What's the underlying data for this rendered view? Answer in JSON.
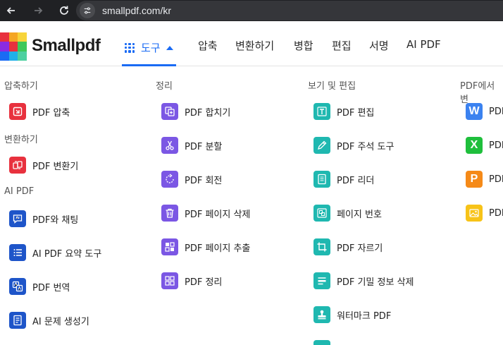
{
  "browser": {
    "url": "smallpdf.com/kr"
  },
  "header": {
    "brand": "Smallpdf",
    "tools_label": "도구",
    "nav": [
      "압축",
      "변환하기",
      "병합",
      "편집",
      "서명",
      "AI PDF"
    ],
    "colors": {
      "accent": "#1a6bf4"
    }
  },
  "menu": {
    "compress_heading": "압축하기",
    "compress_items": [
      {
        "label": "PDF 압축",
        "icon": "compress-icon"
      }
    ],
    "convert_heading": "변환하기",
    "convert_items": [
      {
        "label": "PDF 변환기",
        "icon": "convert-icon"
      }
    ],
    "ai_heading": "AI PDF",
    "ai_items": [
      {
        "label": "PDF와 채팅",
        "icon": "chat-icon"
      },
      {
        "label": "AI PDF 요약 도구",
        "icon": "summary-list-icon"
      },
      {
        "label": "PDF 번역",
        "icon": "translate-icon"
      },
      {
        "label": "AI 문제 생성기",
        "icon": "question-generator-icon"
      }
    ],
    "organize_heading": "정리",
    "organize_items": [
      {
        "label": "PDF 합치기",
        "icon": "merge-icon"
      },
      {
        "label": "PDF 분할",
        "icon": "scissors-icon"
      },
      {
        "label": "PDF 회전",
        "icon": "rotate-icon"
      },
      {
        "label": "PDF 페이지 삭제",
        "icon": "trash-icon"
      },
      {
        "label": "PDF 페이지 추출",
        "icon": "extract-pages-icon"
      },
      {
        "label": "PDF 정리",
        "icon": "organize-grid-icon"
      }
    ],
    "view_edit_heading": "보기 및 편집",
    "view_edit_items": [
      {
        "label": "PDF 편집",
        "icon": "text-edit-icon"
      },
      {
        "label": "PDF 주석 도구",
        "icon": "pen-icon"
      },
      {
        "label": "PDF 리더",
        "icon": "reader-icon"
      },
      {
        "label": "페이지 번호",
        "icon": "page-number-icon"
      },
      {
        "label": "PDF 자르기",
        "icon": "crop-icon"
      },
      {
        "label": "PDF 기밀 정보 삭제",
        "icon": "redact-icon"
      },
      {
        "label": "워터마크 PDF",
        "icon": "stamp-icon"
      }
    ],
    "from_pdf_heading": "PDF에서 변",
    "from_pdf_items": [
      {
        "label": "PDF",
        "icon": "word-icon",
        "letter": "W"
      },
      {
        "label": "PDF",
        "icon": "excel-icon",
        "letter": "X"
      },
      {
        "label": "PDF",
        "icon": "ppt-icon",
        "letter": "P"
      },
      {
        "label": "PDF",
        "icon": "image-icon"
      }
    ]
  }
}
